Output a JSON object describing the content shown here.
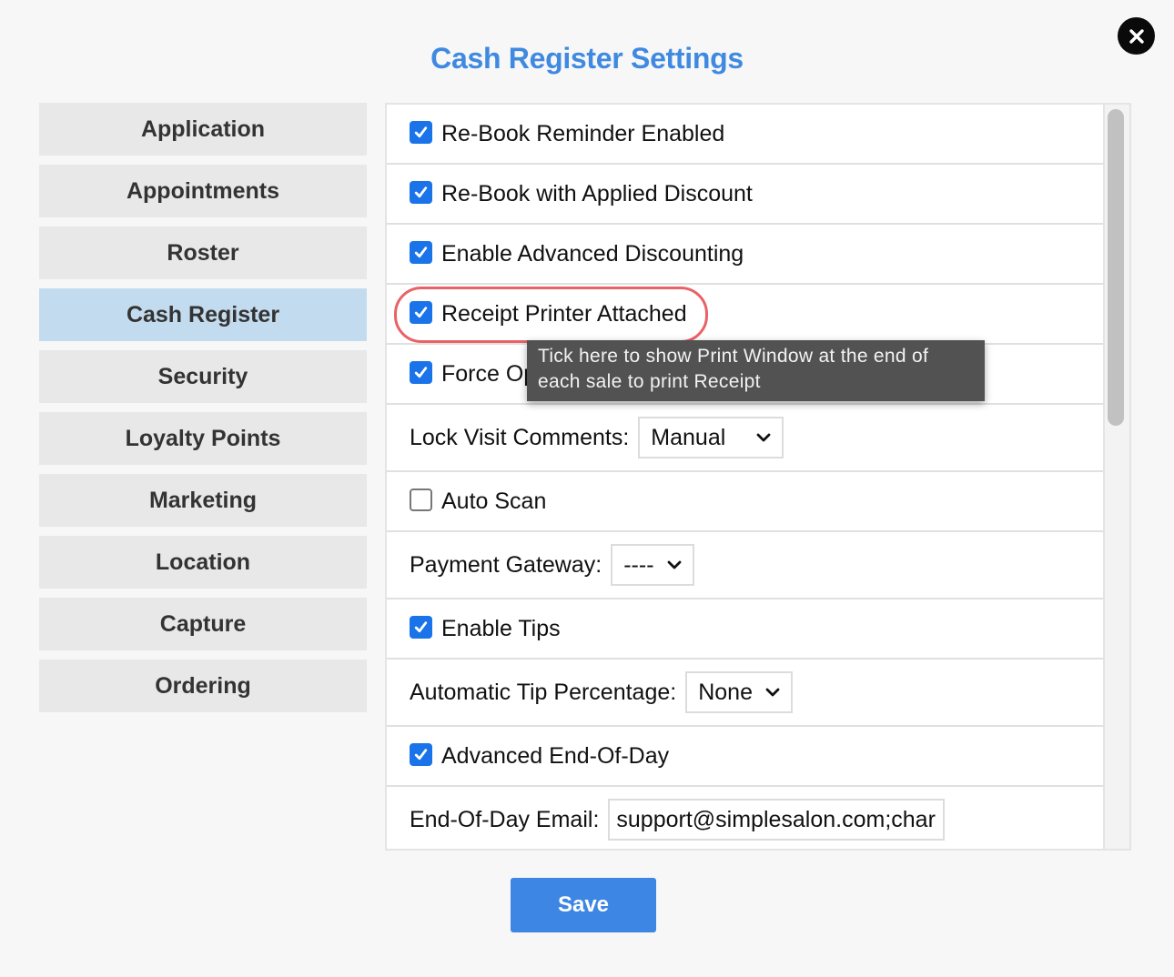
{
  "dialog": {
    "title": "Cash Register Settings",
    "close_icon": "close-icon",
    "save_label": "Save"
  },
  "sidebar": {
    "items": [
      {
        "label": "Application",
        "active": false
      },
      {
        "label": "Appointments",
        "active": false
      },
      {
        "label": "Roster",
        "active": false
      },
      {
        "label": "Cash Register",
        "active": true
      },
      {
        "label": "Security",
        "active": false
      },
      {
        "label": "Loyalty Points",
        "active": false
      },
      {
        "label": "Marketing",
        "active": false
      },
      {
        "label": "Location",
        "active": false
      },
      {
        "label": "Capture",
        "active": false
      },
      {
        "label": "Ordering",
        "active": false
      }
    ]
  },
  "settings": {
    "rebook_reminder": {
      "label": "Re-Book Reminder Enabled",
      "checked": true
    },
    "rebook_discount": {
      "label": "Re-Book with Applied Discount",
      "checked": true
    },
    "advanced_discounting": {
      "label": "Enable Advanced Discounting",
      "checked": true
    },
    "receipt_printer": {
      "label": "Receipt Printer Attached",
      "checked": true
    },
    "force_option": {
      "label": "Force Op",
      "checked": true
    },
    "lock_visit_comments": {
      "label": "Lock Visit Comments:",
      "value": "Manual"
    },
    "auto_scan": {
      "label": "Auto Scan",
      "checked": false
    },
    "payment_gateway": {
      "label": "Payment Gateway:",
      "value": "----"
    },
    "enable_tips": {
      "label": "Enable Tips",
      "checked": true
    },
    "auto_tip_percentage": {
      "label": "Automatic Tip Percentage:",
      "value": "None"
    },
    "advanced_eod": {
      "label": "Advanced End-Of-Day",
      "checked": true
    },
    "eod_email": {
      "label": "End-Of-Day Email:",
      "value": "support@simplesalon.com;char"
    }
  },
  "tooltip": {
    "text_line1": "Tick here to show Print Window at the end of",
    "text_line2": "each sale to print Receipt"
  },
  "colors": {
    "accent": "#3f8ae0",
    "checkbox": "#1a73e8",
    "active_nav": "#c3dbee",
    "highlight_ring": "#e96268",
    "save_button": "#3d86e3"
  }
}
